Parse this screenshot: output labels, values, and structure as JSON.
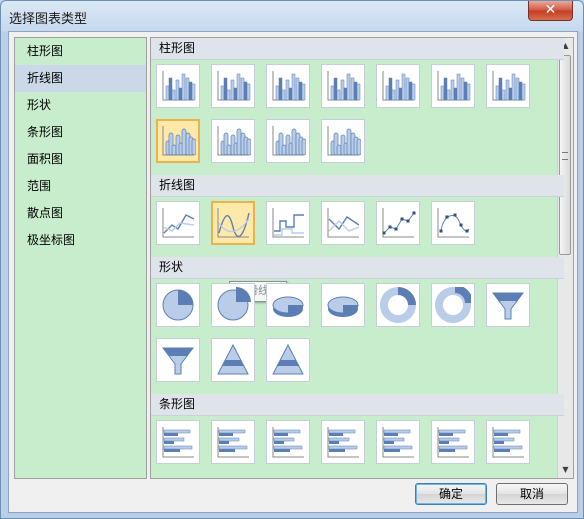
{
  "window": {
    "title": "选择图表类型",
    "close_label": "✕"
  },
  "left_list": [
    "柱形图",
    "折线图",
    "形状",
    "条形图",
    "面积图",
    "范围",
    "散点图",
    "极坐标图"
  ],
  "selected_left": 1,
  "sections": [
    {
      "title": "柱形图",
      "tiles": [
        "column-clustered",
        "column-stacked",
        "column-stacked-100",
        "column-3d-clustered",
        "column-3d-stacked",
        "column-3d-stacked-100",
        "column-3d",
        "cylinder-clustered",
        "cylinder-stacked",
        "cylinder-stacked-100",
        "cylinder-3d"
      ]
    },
    {
      "title": "折线图",
      "tiles": [
        "line",
        "line-smooth",
        "line-step",
        "line-spline-area",
        "line-markers",
        "line-smooth-markers"
      ]
    },
    {
      "title": "形状",
      "tiles": [
        "pie",
        "pie-exploded",
        "pie-3d",
        "pie-3d-exploded",
        "doughnut",
        "doughnut-exploded",
        "funnel",
        "funnel-3d",
        "pyramid",
        "pyramid-3d"
      ]
    },
    {
      "title": "条形图",
      "tiles": [
        "bar-clustered",
        "bar-stacked",
        "bar-stacked-100",
        "bar-3d-clustered",
        "bar-3d-stacked",
        "bar-3d-stacked-100",
        "bar-cylinder"
      ]
    }
  ],
  "highlighted": [
    "column-cylinder-clustered",
    "line-smooth"
  ],
  "tooltip": "平滑线图",
  "buttons": {
    "ok": "确定",
    "cancel": "取消"
  },
  "colors": {
    "list_bg": "#c7edcc",
    "selection": "#cbd8e8",
    "highlight": "#ffe9a8",
    "chart_blue": "#5b7fb5"
  }
}
